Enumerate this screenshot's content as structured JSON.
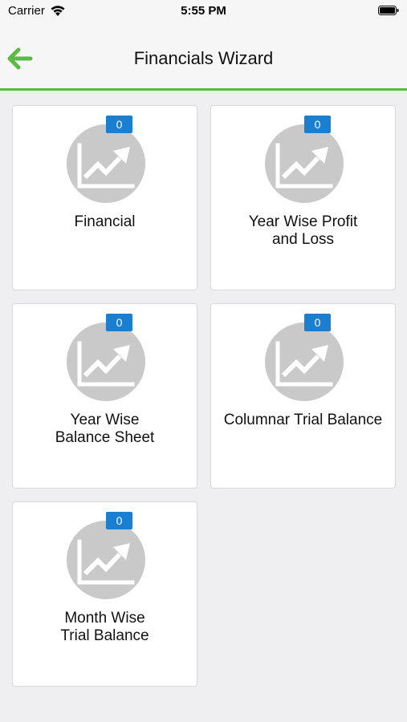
{
  "status_bar": {
    "carrier": "Carrier",
    "time": "5:55 PM",
    "icons": [
      "wifi-icon",
      "battery-icon"
    ]
  },
  "nav": {
    "title": "Financials Wizard",
    "back_icon": "back-arrow-icon",
    "accent_color": "#5cb947"
  },
  "badge_color": "#1a7fd1",
  "cards": [
    {
      "label_lines": [
        "Financial"
      ],
      "badge": "0",
      "icon": "chart-up-icon"
    },
    {
      "label_lines": [
        "Year Wise Profit",
        "and Loss"
      ],
      "badge": "0",
      "icon": "chart-up-icon"
    },
    {
      "label_lines": [
        "Year Wise",
        "Balance Sheet"
      ],
      "badge": "0",
      "icon": "chart-up-icon"
    },
    {
      "label_lines": [
        "Columnar Trial Balance"
      ],
      "badge": "0",
      "icon": "chart-up-icon"
    },
    {
      "label_lines": [
        "Month Wise",
        "Trial Balance"
      ],
      "badge": "0",
      "icon": "chart-up-icon"
    }
  ]
}
